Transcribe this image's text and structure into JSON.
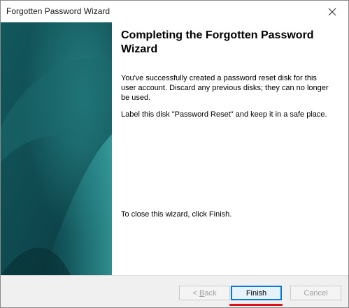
{
  "window": {
    "title": "Forgotten Password Wizard"
  },
  "icons": {
    "close": "close-icon"
  },
  "content": {
    "heading": "Completing the Forgotten Password Wizard",
    "paragraph1": "You've successfully created a password reset disk for this user account. Discard any previous disks; they can no longer be used.",
    "paragraph2": "Label this disk \"Password Reset\" and keep it in a safe place.",
    "paragraph3": "To close this wizard, click Finish."
  },
  "buttons": {
    "back_prefix": "< ",
    "back_accel": "B",
    "back_rest": "ack",
    "finish": "Finish",
    "cancel": "Cancel"
  },
  "colors": {
    "side_panel_dark": "#0b3f44",
    "side_panel_light": "#1a6e72",
    "accent_blue": "#0078d7",
    "highlight_red": "#d9131c"
  }
}
